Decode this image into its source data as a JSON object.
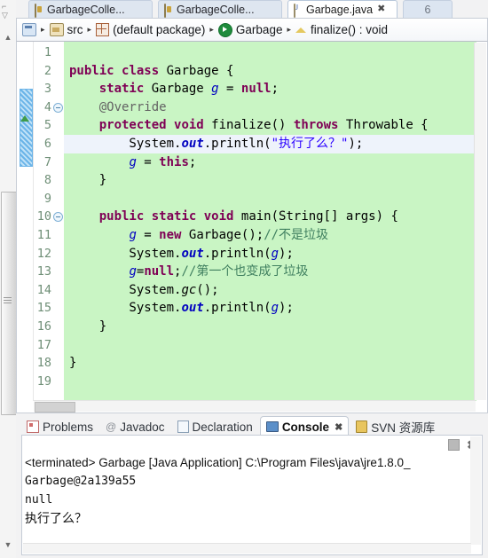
{
  "editor": {
    "tabs": [
      {
        "label": "GarbageColle...",
        "icon": "java-file-icon",
        "active": false,
        "closable": false
      },
      {
        "label": "GarbageColle...",
        "icon": "java-file-icon",
        "active": false,
        "closable": false
      },
      {
        "label": "Garbage.java",
        "icon": "java-file-icon",
        "active": true,
        "closable": true,
        "close": "✖"
      },
      {
        "label": "6",
        "icon": "",
        "active": false,
        "partial": true
      }
    ],
    "breadcrumb": [
      {
        "label": "",
        "icon": "project-icon"
      },
      {
        "label": "src",
        "icon": "source-folder-icon"
      },
      {
        "label": "(default package)",
        "icon": "package-icon"
      },
      {
        "label": "Garbage",
        "icon": "class-icon"
      },
      {
        "label": "finalize() : void",
        "icon": "method-icon"
      }
    ],
    "separator": "▸",
    "line_numbers": [
      "1",
      "2",
      "3",
      "4",
      "5",
      "6",
      "7",
      "8",
      "9",
      "10",
      "11",
      "12",
      "13",
      "14",
      "15",
      "16",
      "17",
      "18",
      "19"
    ],
    "fold_lines": [
      "4",
      "10"
    ],
    "highlighted_line": 6,
    "background_color": "#c9f5c4",
    "highlight_color": "#eef3fb",
    "code_lines": [
      {
        "n": 1,
        "tokens": []
      },
      {
        "n": 2,
        "tokens": [
          {
            "t": "public",
            "c": "kw"
          },
          {
            "t": " ",
            "c": "plain"
          },
          {
            "t": "class",
            "c": "kw"
          },
          {
            "t": " Garbage {",
            "c": "plain"
          }
        ]
      },
      {
        "n": 3,
        "tokens": [
          {
            "t": "    ",
            "c": "plain"
          },
          {
            "t": "static",
            "c": "kw"
          },
          {
            "t": " Garbage ",
            "c": "plain"
          },
          {
            "t": "g",
            "c": "fld"
          },
          {
            "t": " = ",
            "c": "plain"
          },
          {
            "t": "null",
            "c": "kw"
          },
          {
            "t": ";",
            "c": "plain"
          }
        ]
      },
      {
        "n": 4,
        "tokens": [
          {
            "t": "    @Override",
            "c": "ann"
          }
        ]
      },
      {
        "n": 5,
        "tokens": [
          {
            "t": "    ",
            "c": "plain"
          },
          {
            "t": "protected",
            "c": "kw"
          },
          {
            "t": " ",
            "c": "plain"
          },
          {
            "t": "void",
            "c": "kw"
          },
          {
            "t": " finalize() ",
            "c": "plain"
          },
          {
            "t": "throws",
            "c": "kw"
          },
          {
            "t": " Throwable {",
            "c": "plain"
          }
        ]
      },
      {
        "n": 6,
        "tokens": [
          {
            "t": "        System.",
            "c": "plain"
          },
          {
            "t": "out",
            "c": "fldb"
          },
          {
            "t": ".println(",
            "c": "plain"
          },
          {
            "t": "\"执行了么？\"",
            "c": "str"
          },
          {
            "t": ");",
            "c": "plain"
          }
        ]
      },
      {
        "n": 7,
        "tokens": [
          {
            "t": "        ",
            "c": "plain"
          },
          {
            "t": "g",
            "c": "fld"
          },
          {
            "t": " = ",
            "c": "plain"
          },
          {
            "t": "this",
            "c": "kw"
          },
          {
            "t": ";",
            "c": "plain"
          }
        ]
      },
      {
        "n": 8,
        "tokens": [
          {
            "t": "    }",
            "c": "plain"
          }
        ]
      },
      {
        "n": 9,
        "tokens": []
      },
      {
        "n": 10,
        "tokens": [
          {
            "t": "    ",
            "c": "plain"
          },
          {
            "t": "public",
            "c": "kw"
          },
          {
            "t": " ",
            "c": "plain"
          },
          {
            "t": "static",
            "c": "kw"
          },
          {
            "t": " ",
            "c": "plain"
          },
          {
            "t": "void",
            "c": "kw"
          },
          {
            "t": " main(String[] args) {",
            "c": "plain"
          }
        ]
      },
      {
        "n": 11,
        "tokens": [
          {
            "t": "        ",
            "c": "plain"
          },
          {
            "t": "g",
            "c": "fld"
          },
          {
            "t": " = ",
            "c": "plain"
          },
          {
            "t": "new",
            "c": "kw"
          },
          {
            "t": " Garbage();",
            "c": "plain"
          },
          {
            "t": "//不是垃圾",
            "c": "cmt"
          }
        ]
      },
      {
        "n": 12,
        "tokens": [
          {
            "t": "        System.",
            "c": "plain"
          },
          {
            "t": "out",
            "c": "fldb"
          },
          {
            "t": ".println(",
            "c": "plain"
          },
          {
            "t": "g",
            "c": "fld"
          },
          {
            "t": ");",
            "c": "plain"
          }
        ]
      },
      {
        "n": 13,
        "tokens": [
          {
            "t": "        ",
            "c": "plain"
          },
          {
            "t": "g",
            "c": "fld"
          },
          {
            "t": "=",
            "c": "plain"
          },
          {
            "t": "null",
            "c": "kw"
          },
          {
            "t": ";",
            "c": "plain"
          },
          {
            "t": "//第一个也变成了垃圾",
            "c": "cmt"
          }
        ]
      },
      {
        "n": 14,
        "tokens": [
          {
            "t": "        System.",
            "c": "plain"
          },
          {
            "t": "gc",
            "c": "mth"
          },
          {
            "t": "();",
            "c": "plain"
          }
        ]
      },
      {
        "n": 15,
        "tokens": [
          {
            "t": "        System.",
            "c": "plain"
          },
          {
            "t": "out",
            "c": "fldb"
          },
          {
            "t": ".println(",
            "c": "plain"
          },
          {
            "t": "g",
            "c": "fld"
          },
          {
            "t": ");",
            "c": "plain"
          }
        ]
      },
      {
        "n": 16,
        "tokens": [
          {
            "t": "    }",
            "c": "plain"
          }
        ]
      },
      {
        "n": 17,
        "tokens": []
      },
      {
        "n": 18,
        "tokens": [
          {
            "t": "}",
            "c": "plain"
          }
        ]
      },
      {
        "n": 19,
        "tokens": []
      }
    ]
  },
  "bottom_panel": {
    "tabs": [
      {
        "label": "Problems",
        "icon": "problems-icon",
        "active": false
      },
      {
        "label": "Javadoc",
        "icon": "javadoc-icon",
        "active": false
      },
      {
        "label": "Declaration",
        "icon": "declaration-icon",
        "active": false
      },
      {
        "label": "Console",
        "icon": "console-icon",
        "active": true,
        "close": "✖"
      },
      {
        "label": "SVN 资源库",
        "icon": "svn-icon",
        "active": false
      }
    ],
    "toolbar": {
      "stop_label": "stop-button",
      "close_label": "✖"
    },
    "console_output": [
      "<terminated> Garbage [Java Application] C:\\Program Files\\java\\jre1.8.0_",
      "Garbage@2a139a55",
      "null",
      "执行了么？"
    ]
  },
  "window": {
    "scroll_up_arrow": "▲",
    "scroll_down_arrow": "▼"
  }
}
